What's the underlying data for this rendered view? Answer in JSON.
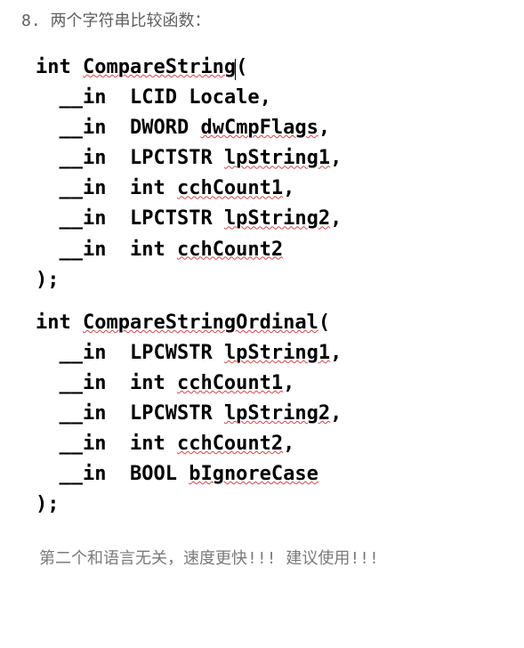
{
  "heading": "8.  两个字符串比较函数：",
  "code1": {
    "sig_open": "int CompareString(",
    "p1": "  __in  LCID Locale,",
    "p2": "  __in  DWORD dwCmpFlags,",
    "p3": "  __in  LPCTSTR lpString1,",
    "p4": "  __in  int cchCount1,",
    "p5": "  __in  LPCTSTR lpString2,",
    "p6": "  __in  int cchCount2",
    "sig_close": ");",
    "tok": {
      "kw1": "int ",
      "fn": "CompareString",
      "open": "(",
      "in": "  __in  ",
      "LCID": "LCID ",
      "Locale": "Locale",
      ",": ",",
      "DWORD": "DWORD ",
      "dwCmpFlags": "dwCmpFlags",
      "LPCTSTR": "LPCTSTR ",
      "lpString1": "lpString1",
      "lpString2": "lpString2",
      "int": "int ",
      "cchCount1": "cchCount1",
      "cchCount2": "cchCount2",
      "close": ");"
    }
  },
  "code2": {
    "sig_open": "int CompareStringOrdinal(",
    "tok": {
      "kw1": "int ",
      "fn": "CompareStringOrdinal",
      "open": "(",
      "in": "  __in  ",
      "LPCWSTR": "LPCWSTR ",
      "lpString1": "lpString1",
      "lpString2": "lpString2",
      "int": "int ",
      "cchCount1": "cchCount1",
      "cchCount2": "cchCount2",
      "BOOL": "BOOL ",
      "bIgnoreCase": "bIgnoreCase",
      ",": ",",
      "close": ");"
    }
  },
  "footnote": "第二个和语言无关，速度更快!!! 建议使用!!!"
}
